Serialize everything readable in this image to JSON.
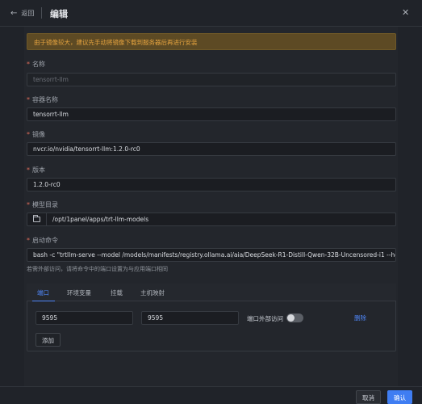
{
  "header": {
    "back_label": "返回",
    "title": "编辑"
  },
  "alert": {
    "text": "由于镜像较大，建议先手动将镜像下载到服务器后再进行安装"
  },
  "form": {
    "name": {
      "label": "名称",
      "value": "tensorrt-llm"
    },
    "container_name": {
      "label": "容器名称",
      "value": "tensorrt-llm"
    },
    "image": {
      "label": "镜像",
      "value": "nvcr.io/nvidia/tensorrt-llm:1.2.0-rc0"
    },
    "version": {
      "label": "版本",
      "value": "1.2.0-rc0"
    },
    "model_dir": {
      "label": "模型目录",
      "value": "/opt/1panel/apps/trt-llm-models"
    },
    "command": {
      "label": "启动命令",
      "value": "bash -c \"trtllm-serve --model /models/manifests/registry.ollama.ai/aia/DeepSeek-R1-Distill-Qwen-32B-Uncensored-i1 --host 0.0.0.0 --"
    },
    "hint": "若需外部访问，请将命令中的端口设置为与应用端口相同"
  },
  "tabs": [
    {
      "label": "端口",
      "active": true
    },
    {
      "label": "环境变量",
      "active": false
    },
    {
      "label": "挂载",
      "active": false
    },
    {
      "label": "主机映射",
      "active": false
    }
  ],
  "port_row": {
    "host_port": "9595",
    "container_port": "9595",
    "external_access_label": "端口外部访问",
    "external_access_enabled": false,
    "delete_label": "删除"
  },
  "add_label": "添加",
  "footer": {
    "cancel_label": "取消",
    "confirm_label": "确认"
  },
  "colors": {
    "accent": "#3f7df2",
    "alert_bg": "#5d4a24",
    "alert_text": "#e5a33f",
    "required": "#e06c5a"
  }
}
